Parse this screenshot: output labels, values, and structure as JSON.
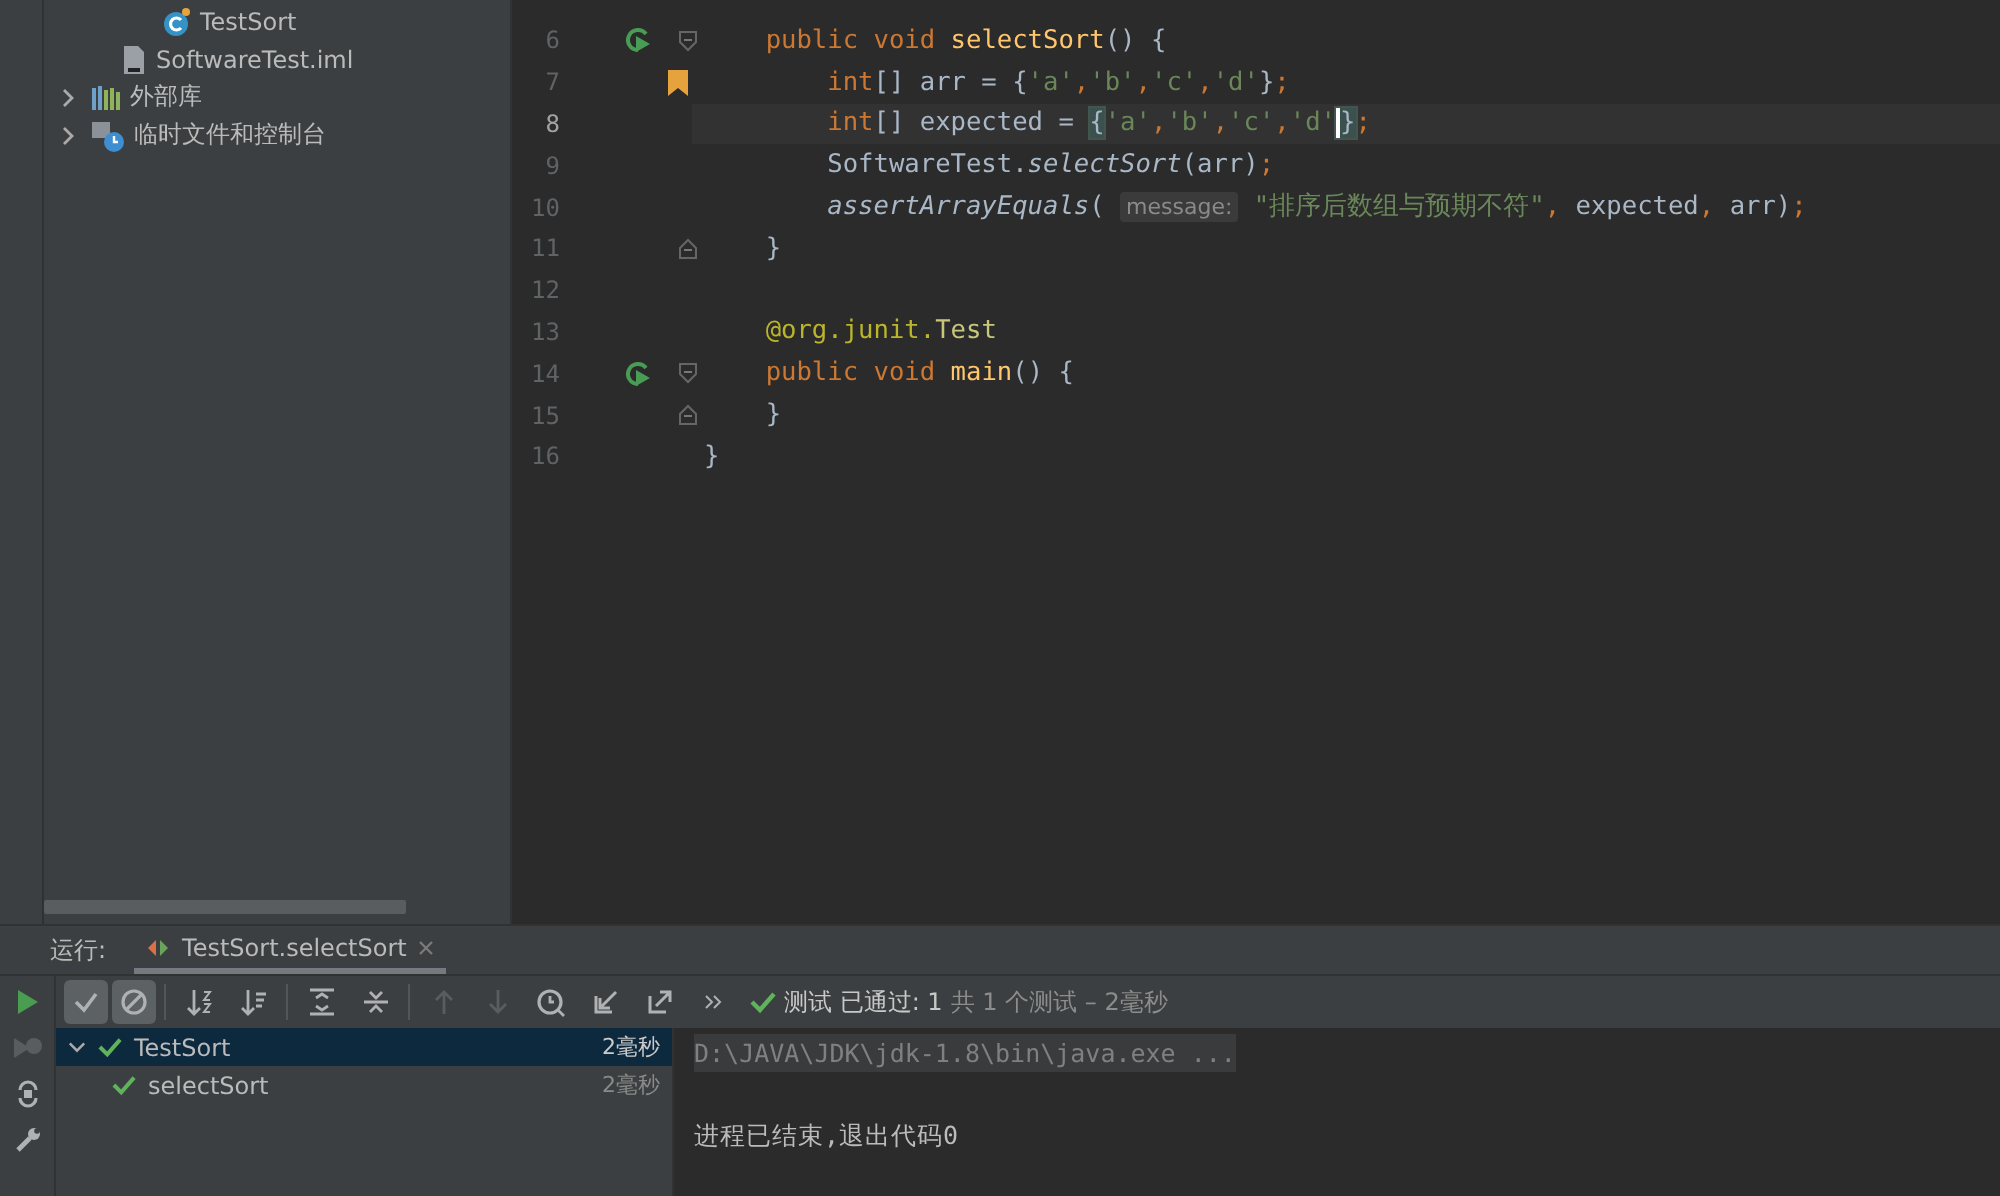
{
  "project_tree": [
    {
      "label": "TestSort",
      "kind": "class"
    },
    {
      "label": "SoftwareTest.iml",
      "kind": "file"
    },
    {
      "label": "外部库",
      "kind": "library",
      "expanded": false
    },
    {
      "label": "临时文件和控制台",
      "kind": "scratches",
      "expanded": false
    }
  ],
  "editor": {
    "lines": [
      {
        "number": "6",
        "current": false,
        "gutter": {
          "kind": "run"
        },
        "fold": {
          "kind": "start"
        },
        "tokens": [
          {
            "kind": "kw",
            "text": "    public void "
          },
          {
            "kind": "decl",
            "text": "selectSort"
          },
          {
            "kind": "plain",
            "text": "() {"
          }
        ]
      },
      {
        "number": "7",
        "current": false,
        "gutter": {
          "kind": "bookmark"
        },
        "tokens": [
          {
            "kind": "kw",
            "text": "        int"
          },
          {
            "kind": "plain",
            "text": "[] arr = {"
          },
          {
            "kind": "str",
            "text": "'a'"
          },
          {
            "kind": "punct",
            "text": ","
          },
          {
            "kind": "str",
            "text": "'b'"
          },
          {
            "kind": "punct",
            "text": ","
          },
          {
            "kind": "str",
            "text": "'c'"
          },
          {
            "kind": "punct",
            "text": ","
          },
          {
            "kind": "str",
            "text": "'d'"
          },
          {
            "kind": "plain",
            "text": "}"
          },
          {
            "kind": "punct",
            "text": ";"
          }
        ]
      },
      {
        "number": "8",
        "current": true,
        "tokens": [
          {
            "kind": "kw",
            "text": "        int"
          },
          {
            "kind": "plain",
            "text": "[] expected = "
          },
          {
            "kind": "brace",
            "text": "{"
          },
          {
            "kind": "str",
            "text": "'a'"
          },
          {
            "kind": "punct",
            "text": ","
          },
          {
            "kind": "str",
            "text": "'b'"
          },
          {
            "kind": "punct",
            "text": ","
          },
          {
            "kind": "str",
            "text": "'c'"
          },
          {
            "kind": "punct",
            "text": ","
          },
          {
            "kind": "str",
            "text": "'d'"
          },
          {
            "kind": "brace",
            "text": "}",
            "caret": true
          },
          {
            "kind": "punct",
            "text": ";"
          }
        ]
      },
      {
        "number": "9",
        "current": false,
        "tokens": [
          {
            "kind": "plain",
            "text": "        SoftwareTest."
          },
          {
            "kind": "static",
            "text": "selectSort"
          },
          {
            "kind": "plain",
            "text": "(arr)"
          },
          {
            "kind": "punct",
            "text": ";"
          }
        ]
      },
      {
        "number": "10",
        "current": false,
        "tokens": [
          {
            "kind": "static",
            "text": "        assertArrayEquals"
          },
          {
            "kind": "plain",
            "text": "( "
          },
          {
            "kind": "hint",
            "text": "message:"
          },
          {
            "kind": "str",
            "text": " \"排序后数组与预期不符\""
          },
          {
            "kind": "punct",
            "text": ","
          },
          {
            "kind": "plain",
            "text": " expected"
          },
          {
            "kind": "punct",
            "text": ","
          },
          {
            "kind": "plain",
            "text": " arr)"
          },
          {
            "kind": "punct",
            "text": ";"
          }
        ]
      },
      {
        "number": "11",
        "current": false,
        "fold": {
          "kind": "end"
        },
        "tokens": [
          {
            "kind": "plain",
            "text": "    }"
          }
        ]
      },
      {
        "number": "12",
        "current": false
      },
      {
        "number": "13",
        "current": false,
        "tokens": [
          {
            "kind": "annot",
            "text": "    @org.junit."
          },
          {
            "kind": "annot-name",
            "text": "Test"
          }
        ]
      },
      {
        "number": "14",
        "current": false,
        "gutter": {
          "kind": "run"
        },
        "fold": {
          "kind": "start"
        },
        "tokens": [
          {
            "kind": "kw",
            "text": "    public void "
          },
          {
            "kind": "decl",
            "text": "main"
          },
          {
            "kind": "plain",
            "text": "() {"
          }
        ]
      },
      {
        "number": "15",
        "current": false,
        "fold": {
          "kind": "end"
        },
        "tokens": [
          {
            "kind": "plain",
            "text": "    }"
          }
        ]
      },
      {
        "number": "16",
        "current": false,
        "tokens": [
          {
            "kind": "plain",
            "text": "}"
          }
        ]
      }
    ]
  },
  "run_panel": {
    "label": "运行:",
    "tabs": [
      {
        "label": "TestSort.selectSort",
        "selected": true
      }
    ],
    "toolbar": [
      {
        "kind": "show-passed",
        "on": true
      },
      {
        "kind": "show-ignored",
        "on": true
      },
      {
        "kind": "sort-alpha",
        "on": false
      },
      {
        "kind": "sort-duration",
        "on": false
      },
      {
        "kind": "expand-all",
        "on": false
      },
      {
        "kind": "collapse-all",
        "on": false
      },
      {
        "kind": "prev",
        "disabled": true
      },
      {
        "kind": "next",
        "disabled": true
      },
      {
        "kind": "history",
        "on": false
      },
      {
        "kind": "import",
        "on": false
      },
      {
        "kind": "export",
        "on": false
      },
      {
        "kind": "more",
        "on": false
      }
    ],
    "side": [
      {
        "kind": "rerun",
        "disabled": false
      },
      {
        "kind": "rerun-failed",
        "disabled": true
      },
      {
        "kind": "toggle",
        "disabled": false
      },
      {
        "kind": "settings",
        "disabled": false
      }
    ],
    "status": {
      "main": "测试 已通过: 1",
      "detail": "共 1 个测试 – 2毫秒"
    },
    "tests": [
      {
        "label": "TestSort",
        "time": "2毫秒",
        "selected": true,
        "expanded": true,
        "children": [
          {
            "label": "selectSort",
            "time": "2毫秒",
            "selected": false
          }
        ]
      }
    ],
    "console": [
      {
        "kind": "command",
        "text": "D:\\JAVA\\JDK\\jdk-1.8\\bin\\java.exe ..."
      },
      {
        "kind": "blank"
      },
      {
        "kind": "output",
        "text": "进程已结束,退出代码0"
      }
    ]
  }
}
